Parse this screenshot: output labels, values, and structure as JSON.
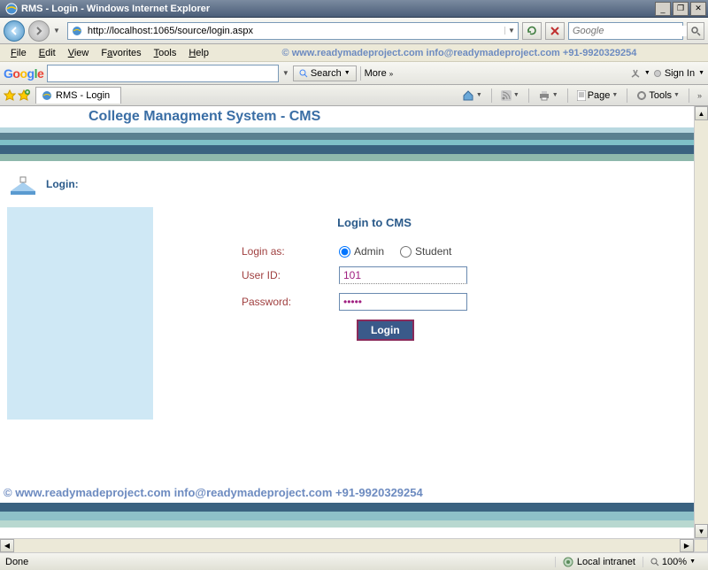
{
  "window": {
    "title": "RMS - Login - Windows Internet Explorer"
  },
  "nav": {
    "url": "http://localhost:1065/source/login.aspx",
    "search_placeholder": "Google"
  },
  "menu": {
    "file": "File",
    "edit": "Edit",
    "view": "View",
    "favorites": "Favorites",
    "tools": "Tools",
    "help": "Help",
    "watermark": "©  www.readymadeproject.com  info@readymadeproject.com  +91-9920329254"
  },
  "gtoolbar": {
    "search": "Search",
    "more": "More",
    "signin": "Sign In"
  },
  "tab": {
    "title": "RMS - Login"
  },
  "commands": {
    "page": "Page",
    "tools": "Tools"
  },
  "page": {
    "title": "College Managment System - CMS",
    "login_label": "Login:",
    "login_heading": "Login to CMS",
    "login_as_label": "Login as:",
    "role_admin": "Admin",
    "role_student": "Student",
    "user_id_label": "User ID:",
    "user_id_value": "101",
    "password_label": "Password:",
    "password_value": "•••••",
    "login_button": "Login",
    "footer_watermark": "©  www.readymadeproject.com  info@readymadeproject.com  +91-9920329254"
  },
  "status": {
    "done": "Done",
    "zone": "Local intranet",
    "zoom": "100%"
  }
}
